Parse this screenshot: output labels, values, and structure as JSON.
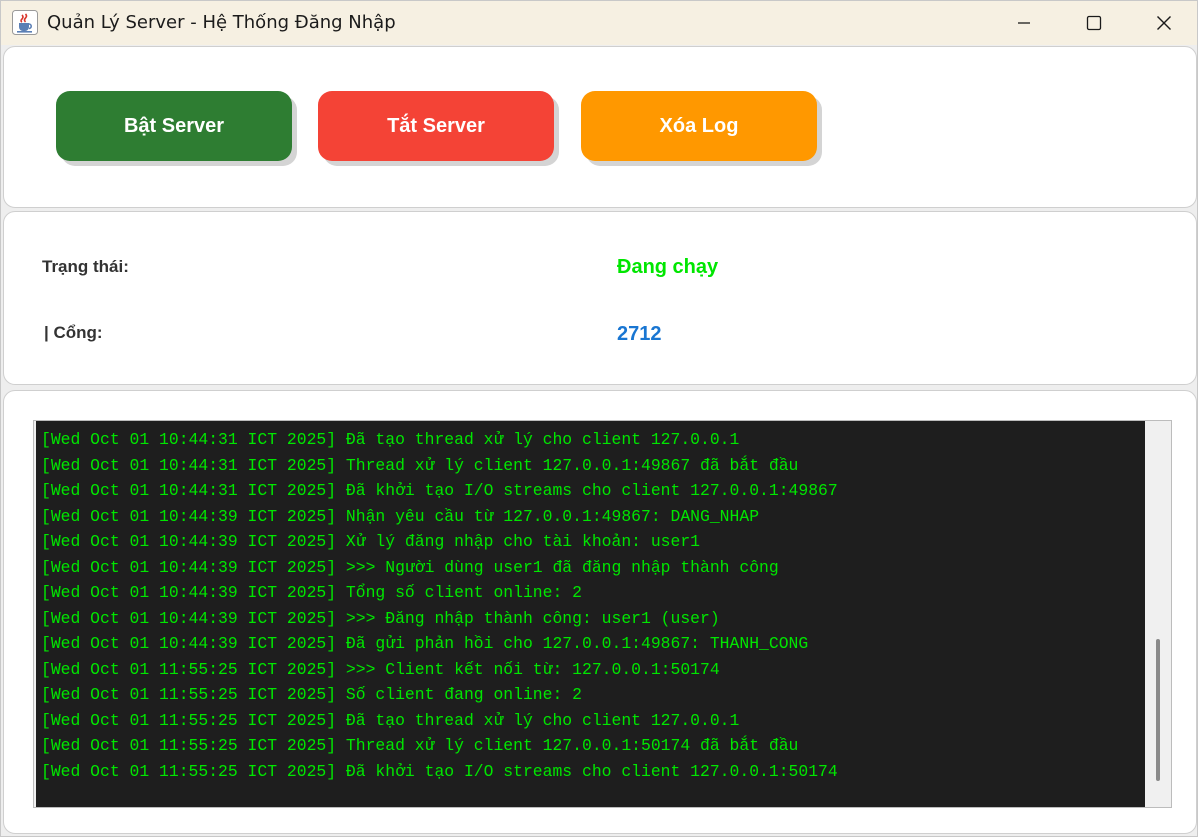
{
  "window": {
    "title": "Quản Lý Server - Hệ Thống Đăng Nhập",
    "icon": "java-coffee-icon"
  },
  "controls": {
    "start_label": "Bật Server",
    "stop_label": "Tắt Server",
    "clear_label": "Xóa Log",
    "colors": {
      "start": "#2e7d32",
      "stop": "#f44336",
      "clear": "#ff9800"
    }
  },
  "status": {
    "state_label": "Trạng thái:",
    "state_value": "Đang chạy",
    "port_label": "| Cổng:",
    "port_value": "2712",
    "colors": {
      "state": "#00e600",
      "port": "#1976d2"
    }
  },
  "log": {
    "lines": [
      "[Wed Oct 01 10:44:31 ICT 2025] Đã tạo thread xử lý cho client 127.0.0.1",
      "[Wed Oct 01 10:44:31 ICT 2025] Thread xử lý client 127.0.0.1:49867 đã bắt đầu",
      "[Wed Oct 01 10:44:31 ICT 2025] Đã khởi tạo I/O streams cho client 127.0.0.1:49867",
      "[Wed Oct 01 10:44:39 ICT 2025] Nhận yêu cầu từ 127.0.0.1:49867: DANG_NHAP",
      "[Wed Oct 01 10:44:39 ICT 2025] Xử lý đăng nhập cho tài khoản: user1",
      "[Wed Oct 01 10:44:39 ICT 2025] >>> Người dùng user1 đã đăng nhập thành công",
      "[Wed Oct 01 10:44:39 ICT 2025] Tổng số client online: 2",
      "[Wed Oct 01 10:44:39 ICT 2025] >>> Đăng nhập thành công: user1 (user)",
      "[Wed Oct 01 10:44:39 ICT 2025] Đã gửi phản hồi cho 127.0.0.1:49867: THANH_CONG",
      "[Wed Oct 01 11:55:25 ICT 2025] >>> Client kết nối từ: 127.0.0.1:50174",
      "[Wed Oct 01 11:55:25 ICT 2025] Số client đang online: 2",
      "[Wed Oct 01 11:55:25 ICT 2025] Đã tạo thread xử lý cho client 127.0.0.1",
      "[Wed Oct 01 11:55:25 ICT 2025] Thread xử lý client 127.0.0.1:50174 đã bắt đầu",
      "[Wed Oct 01 11:55:25 ICT 2025] Đã khởi tạo I/O streams cho client 127.0.0.1:50174"
    ],
    "text_color": "#00e600",
    "background": "#1e1e1e"
  }
}
